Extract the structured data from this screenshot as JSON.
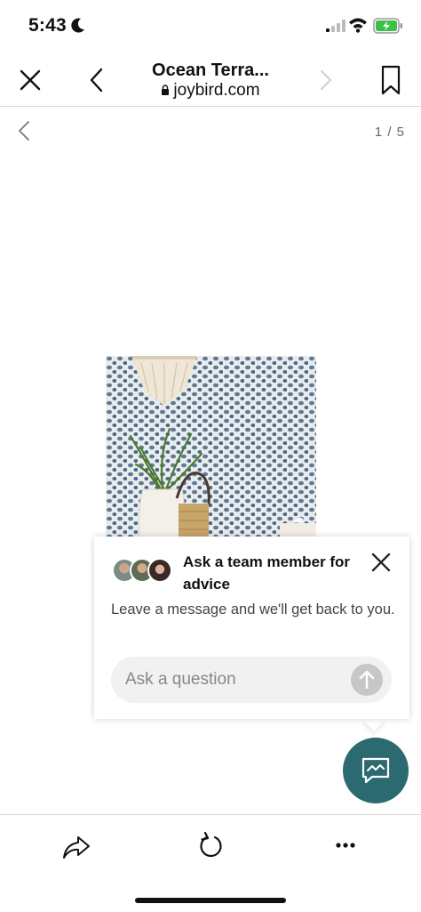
{
  "status_bar": {
    "time": "5:43",
    "icons": [
      "moon-icon",
      "signal-icon",
      "wifi-icon",
      "battery-icon"
    ]
  },
  "browser": {
    "title": "Ocean Terra...",
    "url": "joybird.com",
    "icons": [
      "close-icon",
      "back-arrow-icon",
      "forward-arrow-icon",
      "bookmark-icon",
      "lock-icon"
    ]
  },
  "gallery": {
    "counter": "1 / 5",
    "icons": [
      "chevron-left-icon"
    ]
  },
  "chat_popup": {
    "heading": "Ask a team member for advice",
    "subtext": "Leave a message and we'll get back to you.",
    "input_placeholder": "Ask a question",
    "icons": [
      "close-icon",
      "send-arrow-icon",
      "avatar-group"
    ]
  },
  "chat_fab": {
    "icon": "chat-bubble-icon",
    "color": "#2b6a70"
  },
  "bottom_toolbar": {
    "icons": [
      "share-icon",
      "reload-icon",
      "more-icon"
    ]
  }
}
